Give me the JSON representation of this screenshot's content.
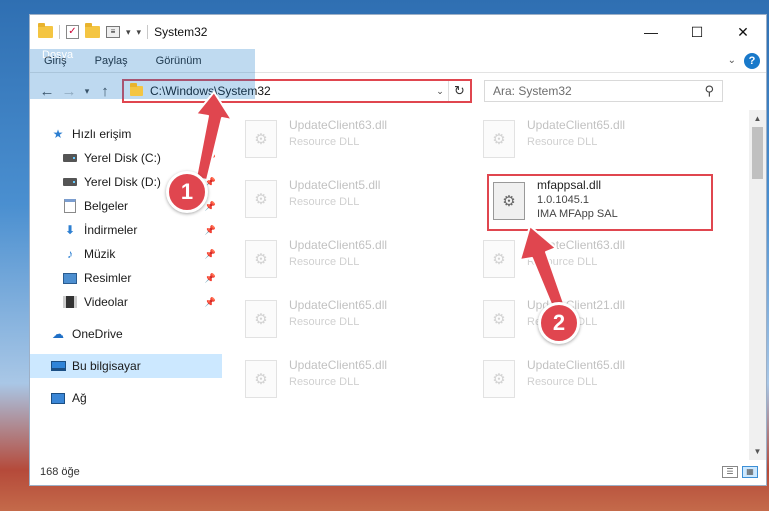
{
  "window": {
    "title": "System32",
    "controls": {
      "minimize": "—",
      "maximize": "☐",
      "close": "✕"
    }
  },
  "ribbon": {
    "tabs": [
      "Dosya",
      "Giriş",
      "Paylaş",
      "Görünüm"
    ],
    "help": "?"
  },
  "nav": {
    "address": "C:\\Windows\\System32",
    "search_placeholder": "Ara: System32"
  },
  "sidebar": {
    "quick_access": "Hızlı erişim",
    "items": [
      {
        "label": "Yerel Disk (C:)",
        "icon": "disk-icon",
        "pinned": true
      },
      {
        "label": "Yerel Disk (D:)",
        "icon": "disk-icon",
        "pinned": true
      },
      {
        "label": "Belgeler",
        "icon": "documents-icon",
        "pinned": true
      },
      {
        "label": "İndirmeler",
        "icon": "downloads-icon",
        "pinned": true
      },
      {
        "label": "Müzik",
        "icon": "music-icon",
        "pinned": true
      },
      {
        "label": "Resimler",
        "icon": "pictures-icon",
        "pinned": true
      },
      {
        "label": "Videolar",
        "icon": "videos-icon",
        "pinned": true
      }
    ],
    "onedrive": "OneDrive",
    "this_pc": "Bu bilgisayar",
    "network": "Ağ"
  },
  "files": [
    {
      "name": "UpdateClient63.dll",
      "desc": "Resource DLL"
    },
    {
      "name": "UpdateClient65.dll",
      "desc": "Resource DLL"
    },
    {
      "name": "UpdateClient5.dll",
      "desc": "Resource DLL"
    },
    {
      "name": "mfappsal.dll",
      "version": "1.0.1045.1",
      "desc": "IMA MFApp SAL"
    },
    {
      "name": "UpdateClient65.dll",
      "desc": "Resource DLL"
    },
    {
      "name": "UpdateClient63.dll",
      "desc": "Resource DLL"
    },
    {
      "name": "UpdateClient65.dll",
      "desc": "Resource DLL"
    },
    {
      "name": "UpdateClient21.dll",
      "desc": "Resource DLL"
    },
    {
      "name": "UpdateClient65.dll",
      "desc": "Resource DLL"
    },
    {
      "name": "UpdateClient65.dll",
      "desc": "Resource DLL"
    }
  ],
  "status": {
    "count": "168 öğe"
  },
  "annotations": {
    "step1": "1",
    "step2": "2"
  },
  "colors": {
    "accent": "#1979ca",
    "highlight": "#e0464f",
    "selected": "#cce8ff"
  }
}
